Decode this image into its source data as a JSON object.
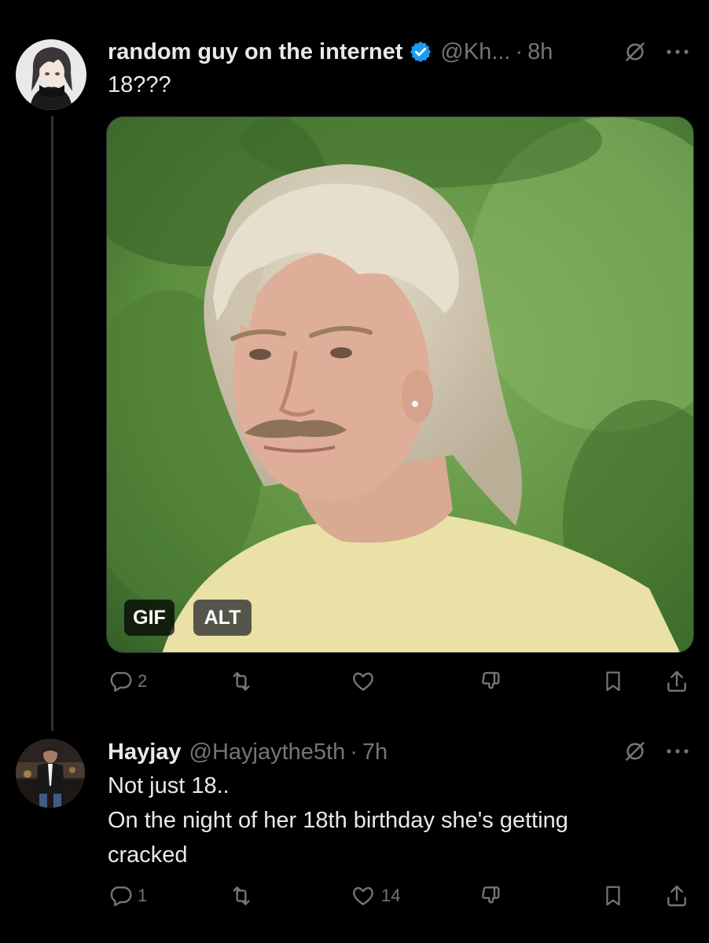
{
  "tweets": [
    {
      "display_name": "random guy on the internet",
      "handle": "@Kh...",
      "separator": "·",
      "time": "8h",
      "text": "18???",
      "avatar_icon": "anime-avatar-icon",
      "media": {
        "type": "gif",
        "gif_badge": "GIF",
        "alt_badge": "ALT"
      },
      "actions": {
        "replies": "2",
        "reposts": "",
        "likes": "",
        "views": ""
      }
    },
    {
      "display_name": "Hayjay",
      "handle": "@Hayjaythe5th",
      "separator": "·",
      "time": "7h",
      "text_lines": [
        "Not just 18..",
        "On the night of her 18th birthday she's getting",
        "cracked"
      ],
      "avatar_icon": "person-avatar-icon",
      "actions": {
        "replies": "1",
        "reposts": "",
        "likes": "14",
        "views": ""
      }
    }
  ],
  "colors": {
    "background": "#000000",
    "text": "#e7e9ea",
    "secondary": "#71767b",
    "verified": "#1d9bf0",
    "divider": "#2f3336"
  }
}
